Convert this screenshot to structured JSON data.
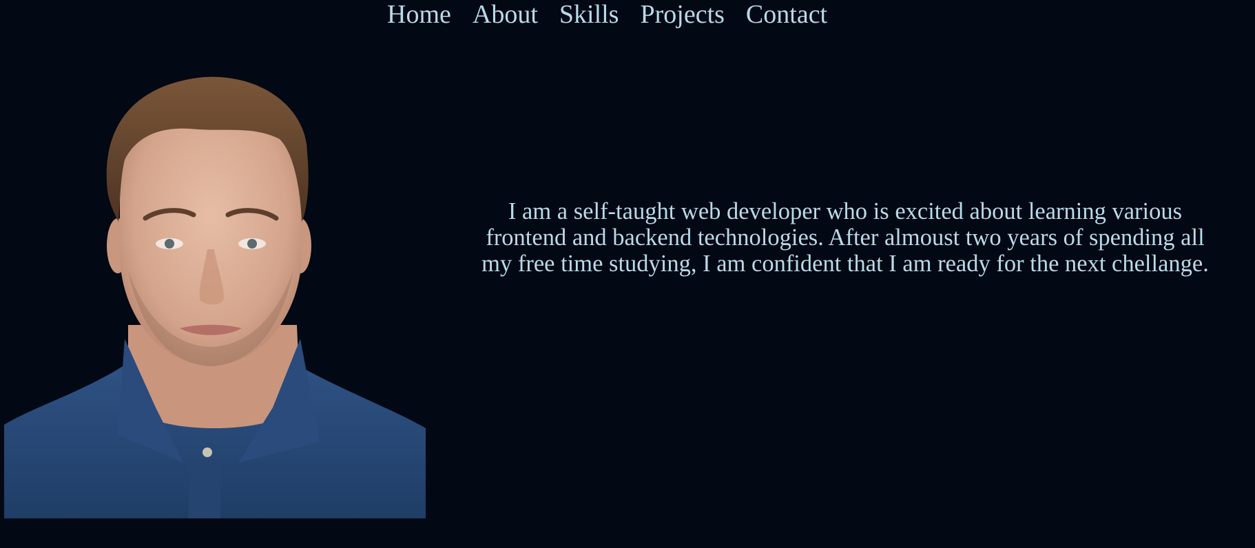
{
  "nav": {
    "items": [
      {
        "label": "Home"
      },
      {
        "label": "About"
      },
      {
        "label": "Skills"
      },
      {
        "label": "Projects"
      },
      {
        "label": "Contact"
      }
    ]
  },
  "about": {
    "text": "I am a self-taught web developer who is excited about learning various frontend and backend technologies. After almoust two years of spending all my free time studying, I am confident that I am ready for the next chellange."
  },
  "colors": {
    "background": "#020814",
    "text": "#b9dbe8",
    "shirt": "#284a7a",
    "skin": "#d9ad95",
    "hair": "#6b4a33"
  }
}
